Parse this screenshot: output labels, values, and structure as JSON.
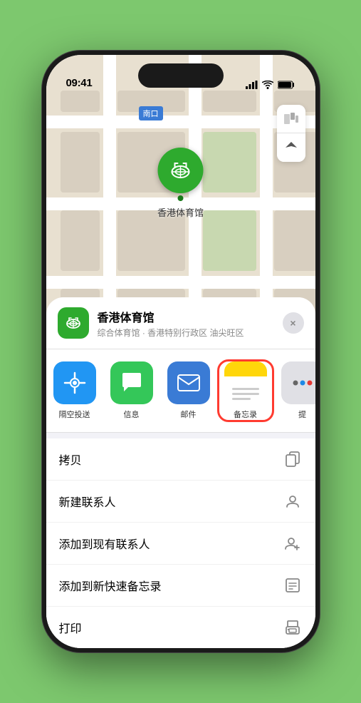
{
  "status": {
    "time": "09:41",
    "time_icon": "location-arrow"
  },
  "map": {
    "north_label": "南口",
    "controls": {
      "map_type": "🗺",
      "location": "↗"
    }
  },
  "location_card": {
    "name": "香港体育馆",
    "description": "综合体育馆 · 香港特别行政区 油尖旺区",
    "close_label": "×"
  },
  "share_items": [
    {
      "id": "airdrop",
      "label": "隔空投送",
      "bg": "airdrop"
    },
    {
      "id": "messages",
      "label": "信息",
      "bg": "messages"
    },
    {
      "id": "mail",
      "label": "邮件",
      "bg": "mail"
    },
    {
      "id": "notes",
      "label": "备忘录",
      "bg": "notes",
      "selected": true
    },
    {
      "id": "more",
      "label": "提",
      "bg": "more"
    }
  ],
  "actions": [
    {
      "id": "copy",
      "label": "拷贝",
      "icon": "copy"
    },
    {
      "id": "new-contact",
      "label": "新建联系人",
      "icon": "person"
    },
    {
      "id": "add-existing",
      "label": "添加到现有联系人",
      "icon": "person-add"
    },
    {
      "id": "quick-note",
      "label": "添加到新快速备忘录",
      "icon": "note"
    },
    {
      "id": "print",
      "label": "打印",
      "icon": "printer"
    }
  ],
  "stadium_label": "香港体育馆"
}
